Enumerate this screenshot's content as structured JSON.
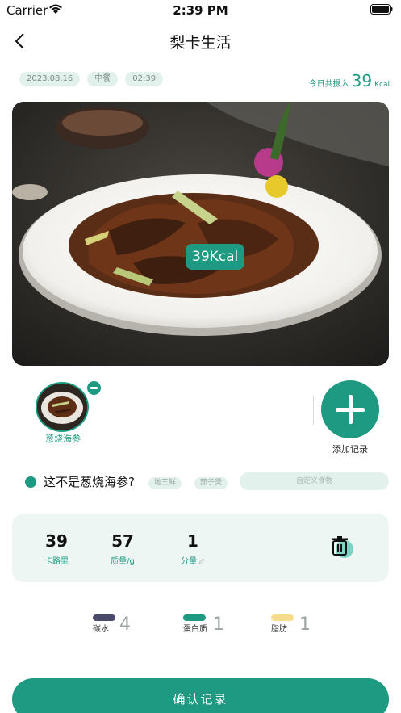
{
  "status_bar": {
    "carrier": "Carrier",
    "time": "2:39 PM"
  },
  "nav": {
    "title": "梨卡生活",
    "back_icon": "chevron-left-icon"
  },
  "meta": {
    "date": "2023.08.16",
    "meal": "中餐",
    "time": "02:39"
  },
  "intake": {
    "label": "今日共摄入",
    "value": "39",
    "unit": "Kcal"
  },
  "photo": {
    "kcal_label": "39Kcal"
  },
  "food_items": [
    {
      "name": "葱烧海参"
    }
  ],
  "add_record": {
    "label": "添加记录",
    "icon": "plus-icon"
  },
  "recognition": {
    "question": "这不是葱烧海参?",
    "alternatives": [
      "地三鲜",
      "茄子煲"
    ],
    "custom_label": "自定义食物"
  },
  "stats": {
    "calories": {
      "value": "39",
      "label": "卡路里"
    },
    "mass": {
      "value": "57",
      "label": "质量/g"
    },
    "portion": {
      "value": "1",
      "label": "分量"
    }
  },
  "macros": [
    {
      "label": "碳水",
      "value": "4",
      "color": "#4a4a6a"
    },
    {
      "label": "蛋白质",
      "value": "1",
      "color": "#1f9a82"
    },
    {
      "label": "脂肪",
      "value": "1",
      "color": "#f5dc8c"
    }
  ],
  "confirm_button": "确认记录",
  "colors": {
    "accent": "#1f9a82",
    "chip_bg": "#e3f1ec",
    "card_bg": "#eef6f3"
  }
}
